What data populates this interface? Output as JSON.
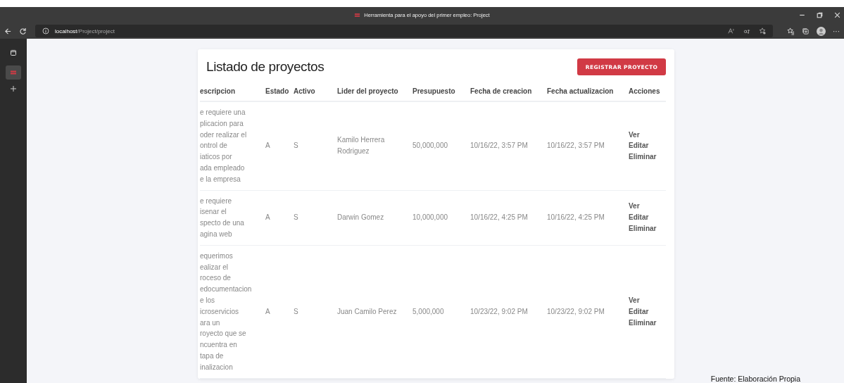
{
  "browser": {
    "title": "Herramienta para el apoyo del primer empleo: Project",
    "url_host": "localhost",
    "url_path": "/Project/project",
    "more": "···"
  },
  "sidebar": {
    "tabs": [
      {
        "kind": "tabs",
        "selected": false
      },
      {
        "kind": "site",
        "selected": true
      }
    ]
  },
  "page": {
    "title": "Listado de proyectos",
    "button": "REGISTRAR PROYECTO"
  },
  "table": {
    "columns": [
      "escripcion",
      "Estado",
      "Activo",
      "Lider del proyecto",
      "Presupuesto",
      "Fecha de creacion",
      "Fecha actualizacion",
      "Acciones"
    ],
    "rows": [
      {
        "description": [
          "e requiere una",
          "plicacion para",
          "oder realizar el",
          "ontrol de",
          "iaticos por",
          "ada empleado",
          "e la empresa"
        ],
        "estado": "A",
        "activo": "S",
        "lider": "Kamilo Herrera Rodriguez",
        "presupuesto": "50,000,000",
        "creacion": "10/16/22, 3:57 PM",
        "actualizacion": "10/16/22, 3:57 PM",
        "actions": [
          "Ver",
          "Editar",
          "Eliminar"
        ]
      },
      {
        "description": [
          "e requiere",
          "isenar el",
          "specto de una",
          "agina web"
        ],
        "estado": "A",
        "activo": "S",
        "lider": "Darwin Gomez",
        "presupuesto": "10,000,000",
        "creacion": "10/16/22, 4:25 PM",
        "actualizacion": "10/16/22, 4:25 PM",
        "actions": [
          "Ver",
          "Editar",
          "Eliminar"
        ]
      },
      {
        "description": [
          "equerimos",
          "ealizar el",
          "roceso de",
          "edocumentacion",
          "e los",
          "icroservicios",
          "ara un",
          "royecto que se",
          "ncuentra en",
          "tapa de",
          "inalizacion"
        ],
        "estado": "A",
        "activo": "S",
        "lider": "Juan Camilo Perez",
        "presupuesto": "5,000,000",
        "creacion": "10/23/22, 9:02 PM",
        "actualizacion": "10/23/22, 9:02 PM",
        "actions": [
          "Ver",
          "Editar",
          "Eliminar"
        ]
      }
    ]
  },
  "caption": "Fuente: Elaboración Propia"
}
